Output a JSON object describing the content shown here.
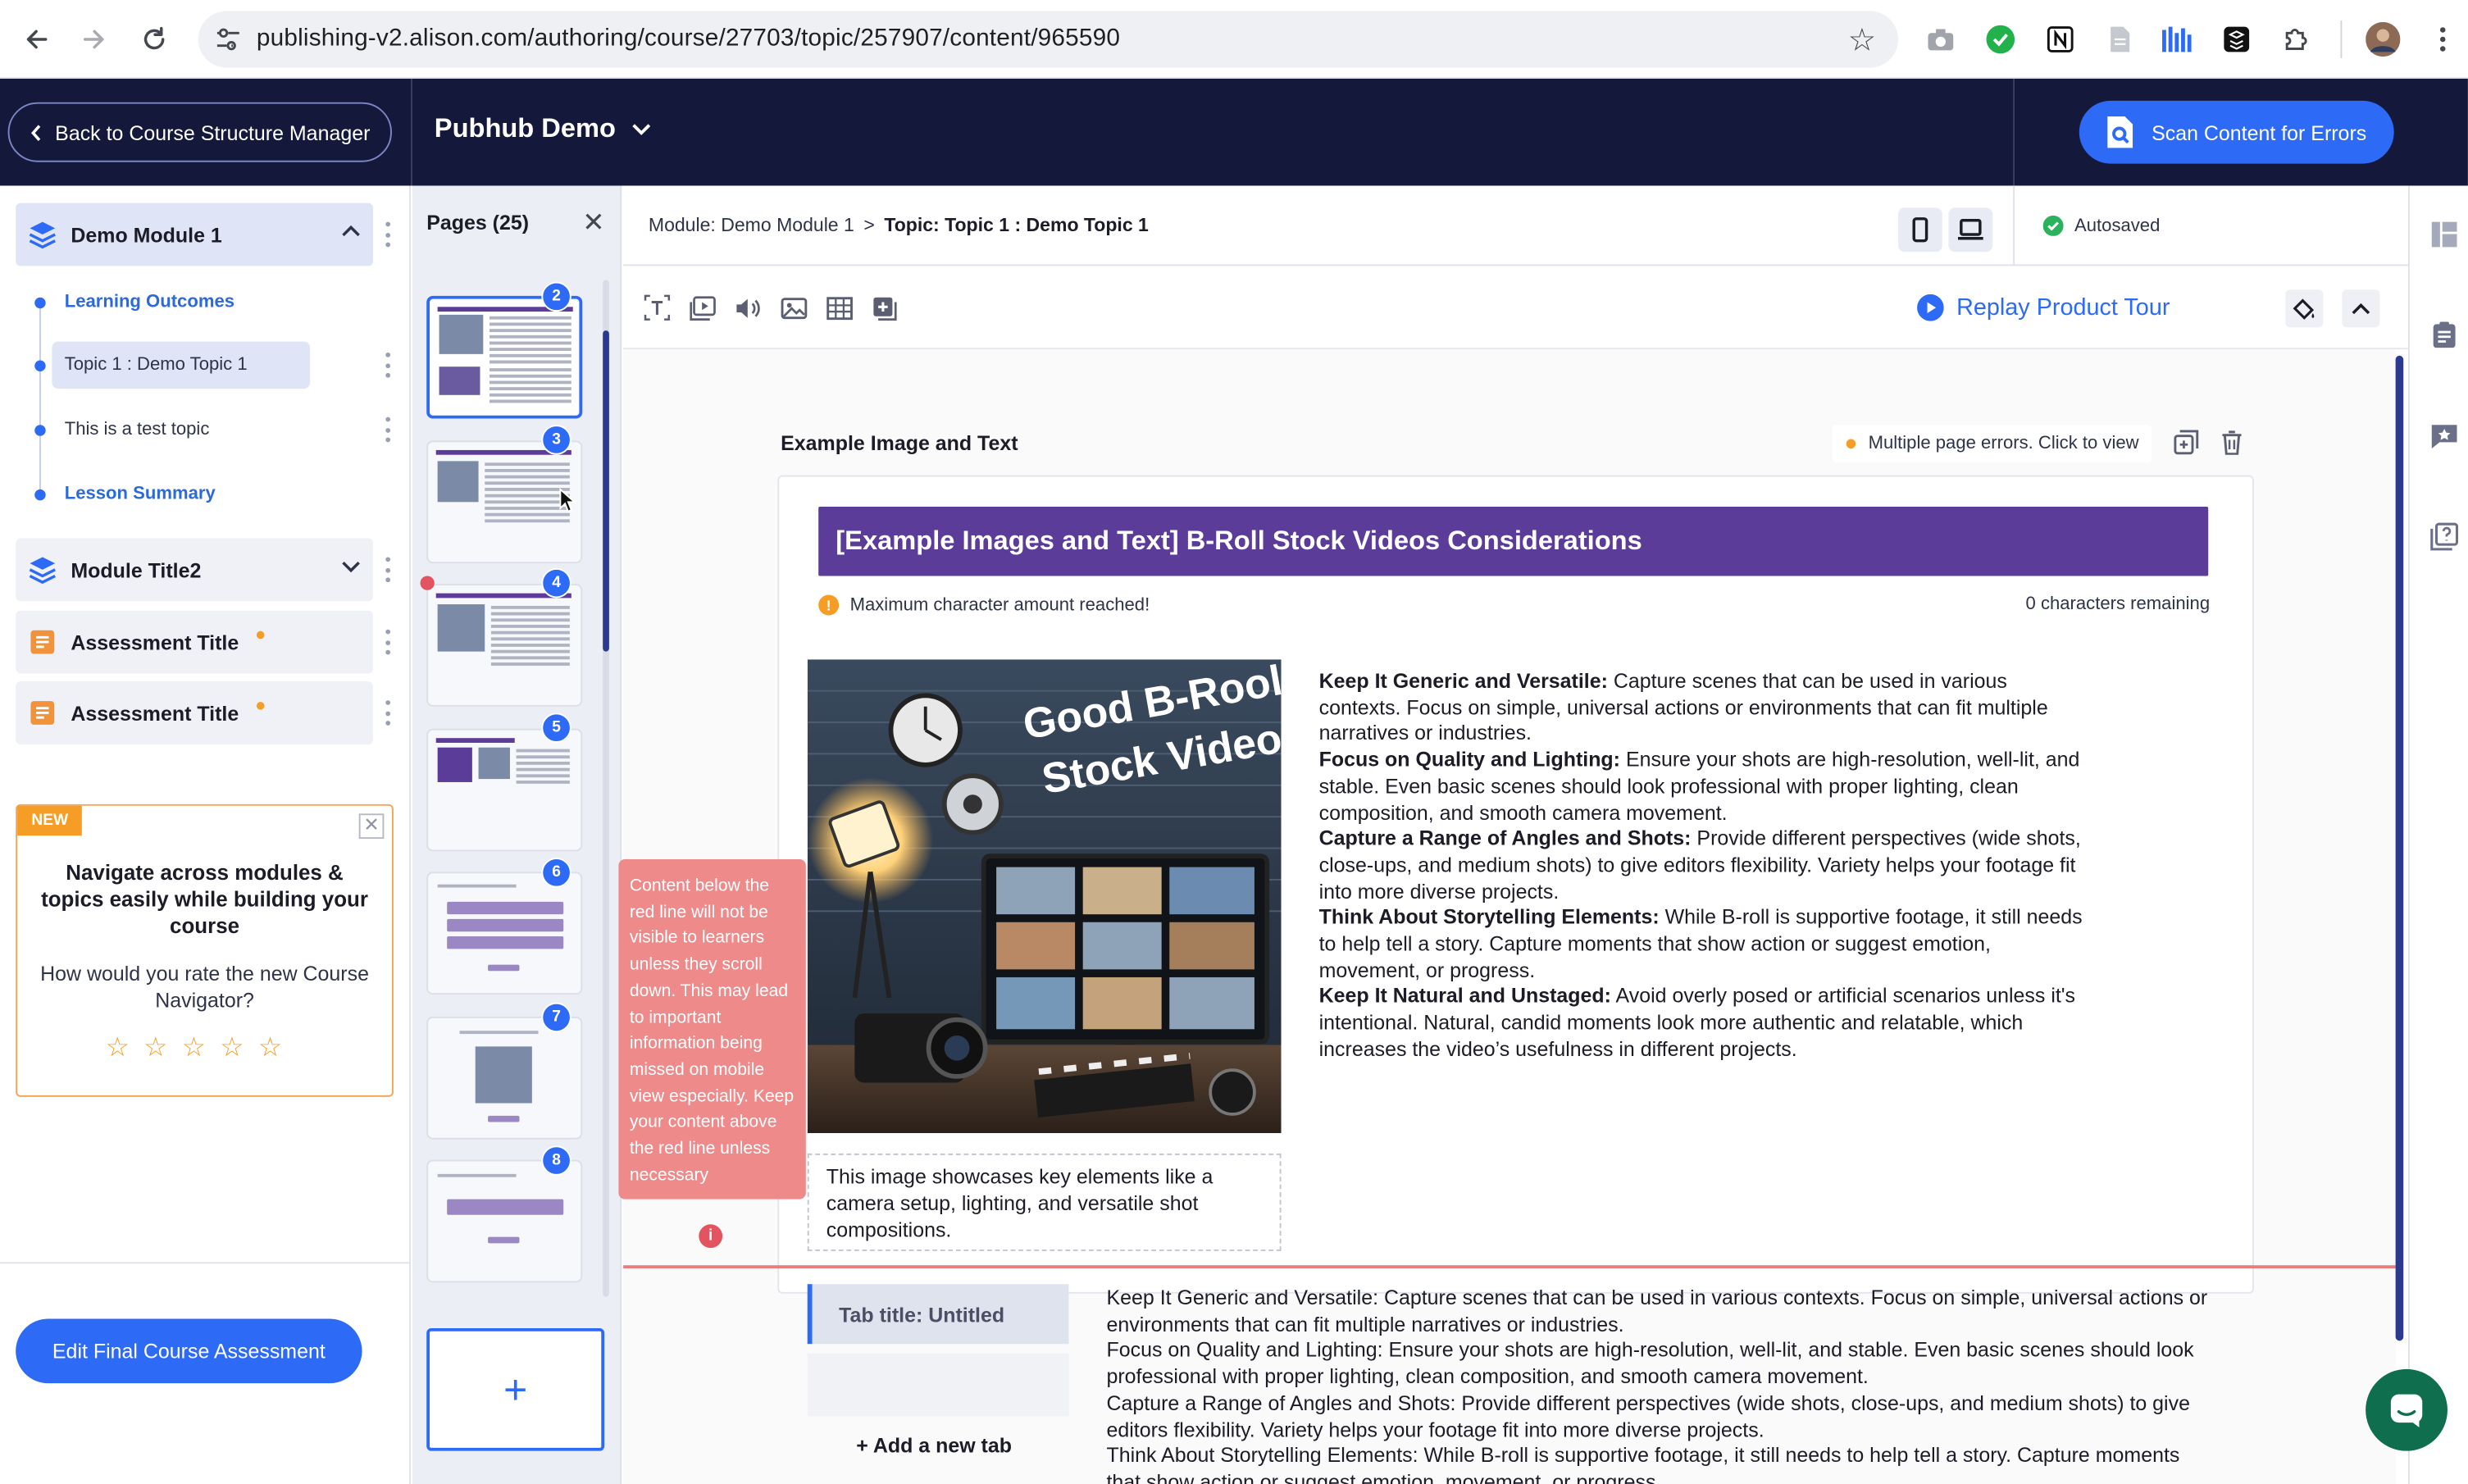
{
  "browser": {
    "url": "publishing-v2.alison.com/authoring/course/27703/topic/257907/content/965590",
    "nav_icons": [
      "back-arrow-icon",
      "forward-arrow-icon",
      "reload-icon",
      "site-info-icon",
      "bookmark-star-icon"
    ],
    "extension_icons": [
      "camera-icon",
      "green-extension-icon",
      "notion-icon",
      "document-icon",
      "bar-chart-icon",
      "tiling-icon",
      "puzzle-icon",
      "profile-avatar",
      "more-vert-icon"
    ]
  },
  "header": {
    "back_label": "Back to Course Structure Manager",
    "project_title": "Pubhub Demo",
    "scan_label": "Scan Content for Errors",
    "colors": {
      "bg": "#14183a",
      "accent": "#2d6af5"
    }
  },
  "sidebar": {
    "modules": [
      {
        "title": "Demo Module 1",
        "expanded": true,
        "topics": [
          {
            "label": "Learning Outcomes",
            "style": "link"
          },
          {
            "label": "Topic 1 : Demo Topic 1",
            "style": "selected"
          },
          {
            "label": "This is a test topic",
            "style": "plain"
          },
          {
            "label": "Lesson Summary",
            "style": "link"
          }
        ]
      },
      {
        "title": "Module Title2",
        "expanded": false
      },
      {
        "title": "Assessment Title",
        "type": "assessment"
      },
      {
        "title": "Assessment Title",
        "type": "assessment"
      }
    ],
    "new_card": {
      "badge": "NEW",
      "headline": "Navigate across modules & topics easily while building your course",
      "question": "How would you rate the new Course Navigator?",
      "star_count": 5,
      "close": "✕"
    },
    "edit_final_label": "Edit Final Course Assessment"
  },
  "pages_panel": {
    "title": "Pages (25)",
    "close": "✕",
    "thumbs": [
      "2",
      "3",
      "4",
      "5",
      "6",
      "7",
      "8"
    ],
    "selected": "2",
    "add_label": "+"
  },
  "editor": {
    "breadcrumb": {
      "module": "Module: Demo Module 1",
      "sep": ">",
      "topic": "Topic: Topic 1 : Demo Topic 1"
    },
    "status": "Autosaved",
    "replay_label": "Replay Product Tour",
    "block": {
      "title": "Example Image and Text",
      "errors_label": "Multiple page errors. Click to view",
      "banner": "[Example Images and Text] B-Roll Stock Videos Considerations",
      "max_chars": "Maximum character amount reached!",
      "remaining": "0 characters remaining",
      "hero_text_line1": "Good B-Rooll",
      "hero_text_line2": "Stock Videos",
      "caption": "This image showcases key elements like a camera setup, lighting, and versatile shot compositions.",
      "points": [
        {
          "b": "Keep It Generic and Versatile:",
          "t": " Capture scenes that can be used in various contexts. Focus on simple, universal actions or environments that can fit multiple narratives or industries."
        },
        {
          "b": "Focus on Quality and Lighting:",
          "t": " Ensure your shots are high-resolution, well-lit, and stable. Even basic scenes should look professional with proper lighting, clean composition, and smooth camera movement."
        },
        {
          "b": "Capture a Range of Angles and Shots:",
          "t": " Provide different perspectives (wide shots, close-ups, and medium shots) to give editors flexibility. Variety helps your footage fit into more diverse projects."
        },
        {
          "b": "Think About Storytelling Elements:",
          "t": " While B-roll is supportive footage, it still needs to help tell a story. Capture moments that show action or suggest emotion, movement, or progress."
        },
        {
          "b": "Keep It Natural and Unstaged:",
          "t": " Avoid overly posed or artificial scenarios unless it's intentional. Natural, candid moments look more authentic and relatable, which increases the video’s usefulness in different projects."
        }
      ]
    },
    "red_line_warning": "Content below the red line will not be visible to learners unless they scroll down. This may lead to important information being missed on mobile view especially. Keep your content above the red line unless necessary",
    "tabs_block": {
      "tab_title": "Tab title: Untitled",
      "add_tab": "+ Add a new tab",
      "lines": [
        "Keep It Generic and Versatile: Capture scenes that can be used in various contexts. Focus on simple, universal actions or environments that can fit multiple narratives or industries.",
        "Focus on Quality and Lighting: Ensure your shots are high-resolution, well-lit, and stable. Even basic scenes should look professional with proper lighting, clean composition, and smooth camera movement.",
        "Capture a Range of Angles and Shots: Provide different perspectives (wide shots, close-ups, and medium shots) to give editors flexibility. Variety helps your footage fit into more diverse projects.",
        "Think About Storytelling Elements: While B-roll is supportive footage, it still needs to help tell a story. Capture moments that show action or suggest emotion, movement, or progress."
      ]
    }
  }
}
